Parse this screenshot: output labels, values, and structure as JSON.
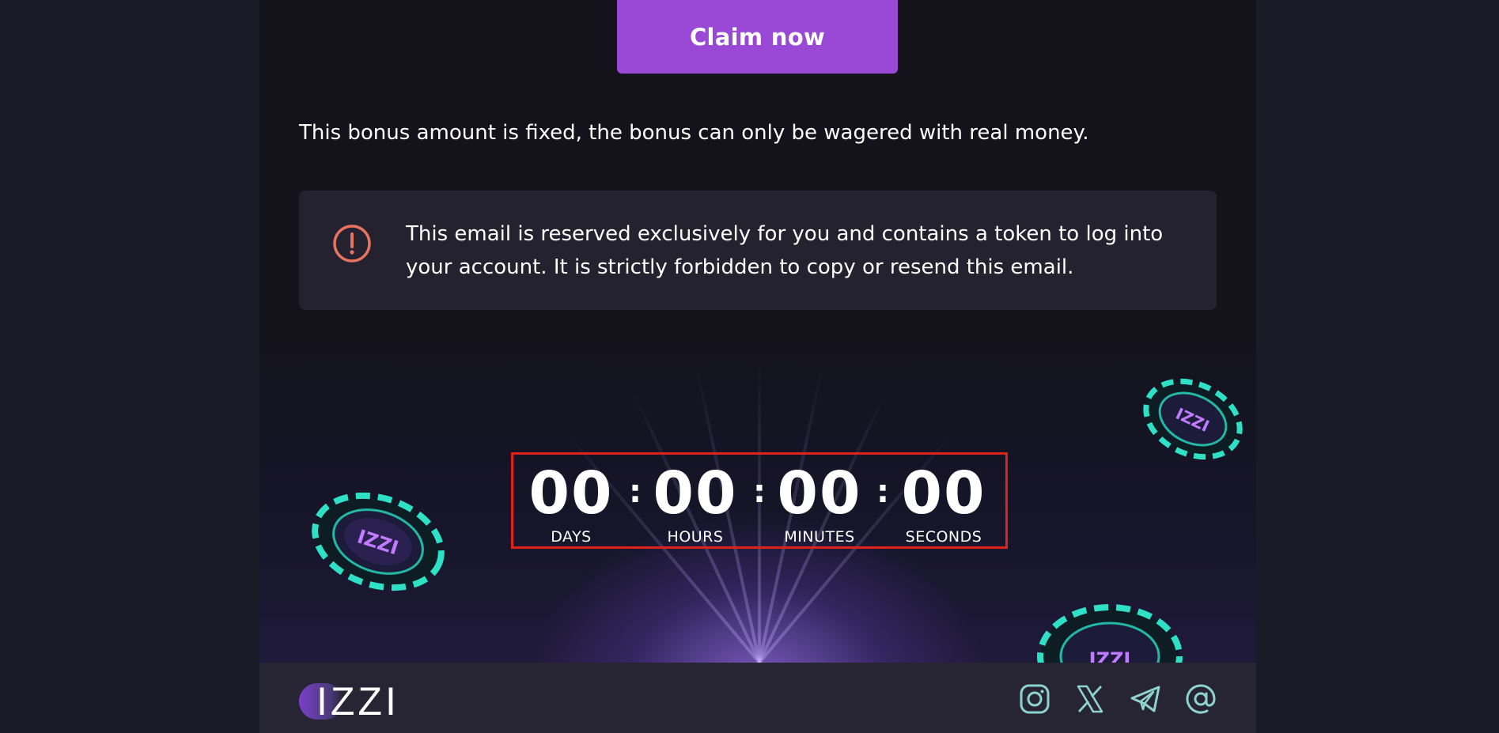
{
  "email": {
    "claim_button_label": "Claim now",
    "bonus_text": "This bonus amount is fixed, the bonus can only be wagered with real money.",
    "notice": {
      "icon": "exclamation-circle-icon",
      "text": "This email is reserved exclusively for you and contains a token to log into your account. It is strictly forbidden to copy or resend this email."
    },
    "countdown": {
      "days": "00",
      "hours": "00",
      "minutes": "00",
      "seconds": "00",
      "separator": ":",
      "days_label": "DAYS",
      "hours_label": "HOURS",
      "minutes_label": "MINUTES",
      "seconds_label": "SECONDS"
    },
    "footer": {
      "logo_text": "IZZI",
      "social": [
        "instagram-icon",
        "x-icon",
        "telegram-icon",
        "at-icon"
      ]
    }
  },
  "colors": {
    "page_bg": "#1b1a27",
    "email_bg": "#14131c",
    "accent": "#9a49d6",
    "notice_bg": "#24222f",
    "warning_icon": "#e8735f",
    "highlight_border": "#e0221d",
    "footer_bg": "#272434",
    "icon_teal": "#8fd3cf"
  }
}
